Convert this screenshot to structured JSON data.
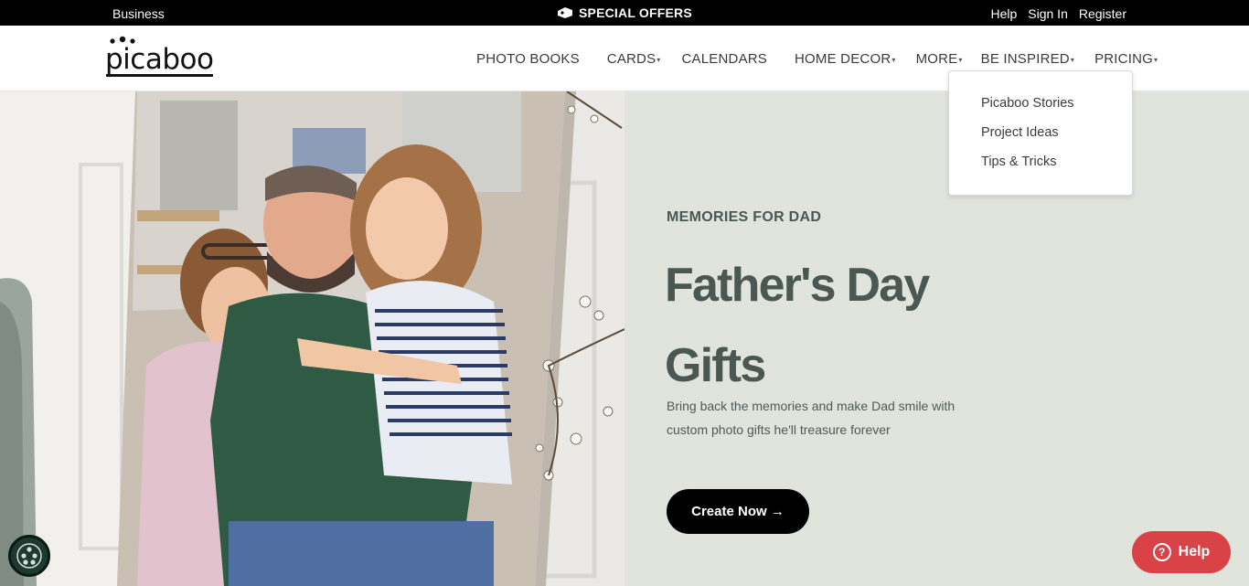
{
  "topbar": {
    "business": "Business",
    "special_offers": "SPECIAL OFFERS",
    "help": "Help",
    "sign_in": "Sign In",
    "register": "Register"
  },
  "header": {
    "logo_text": "picaboo",
    "nav": [
      {
        "label": "PHOTO BOOKS",
        "has_caret": false
      },
      {
        "label": "CARDS",
        "has_caret": true
      },
      {
        "label": "CALENDARS",
        "has_caret": false
      },
      {
        "label": "HOME DECOR",
        "has_caret": true
      },
      {
        "label": "MORE",
        "has_caret": true
      },
      {
        "label": "BE INSPIRED",
        "has_caret": true
      },
      {
        "label": "PRICING",
        "has_caret": true
      }
    ]
  },
  "dropdown": {
    "items": [
      "Picaboo Stories",
      "Project Ideas",
      "Tips & Tricks"
    ]
  },
  "hero": {
    "eyebrow": "MEMORIES FOR DAD",
    "title": "Father's Day Gifts",
    "subtitle": "Bring back the memories and make Dad smile with custom photo gifts he'll treasure forever",
    "cta": "Create Now →"
  },
  "widgets": {
    "help_label": "Help",
    "help_icon": "question-icon",
    "accessibility_icon": "accessibility-icon"
  },
  "colors": {
    "hero_bg": "#e0e4dd",
    "heading": "#4a5753",
    "help_button": "#d94348",
    "cta_bg": "#000000"
  }
}
